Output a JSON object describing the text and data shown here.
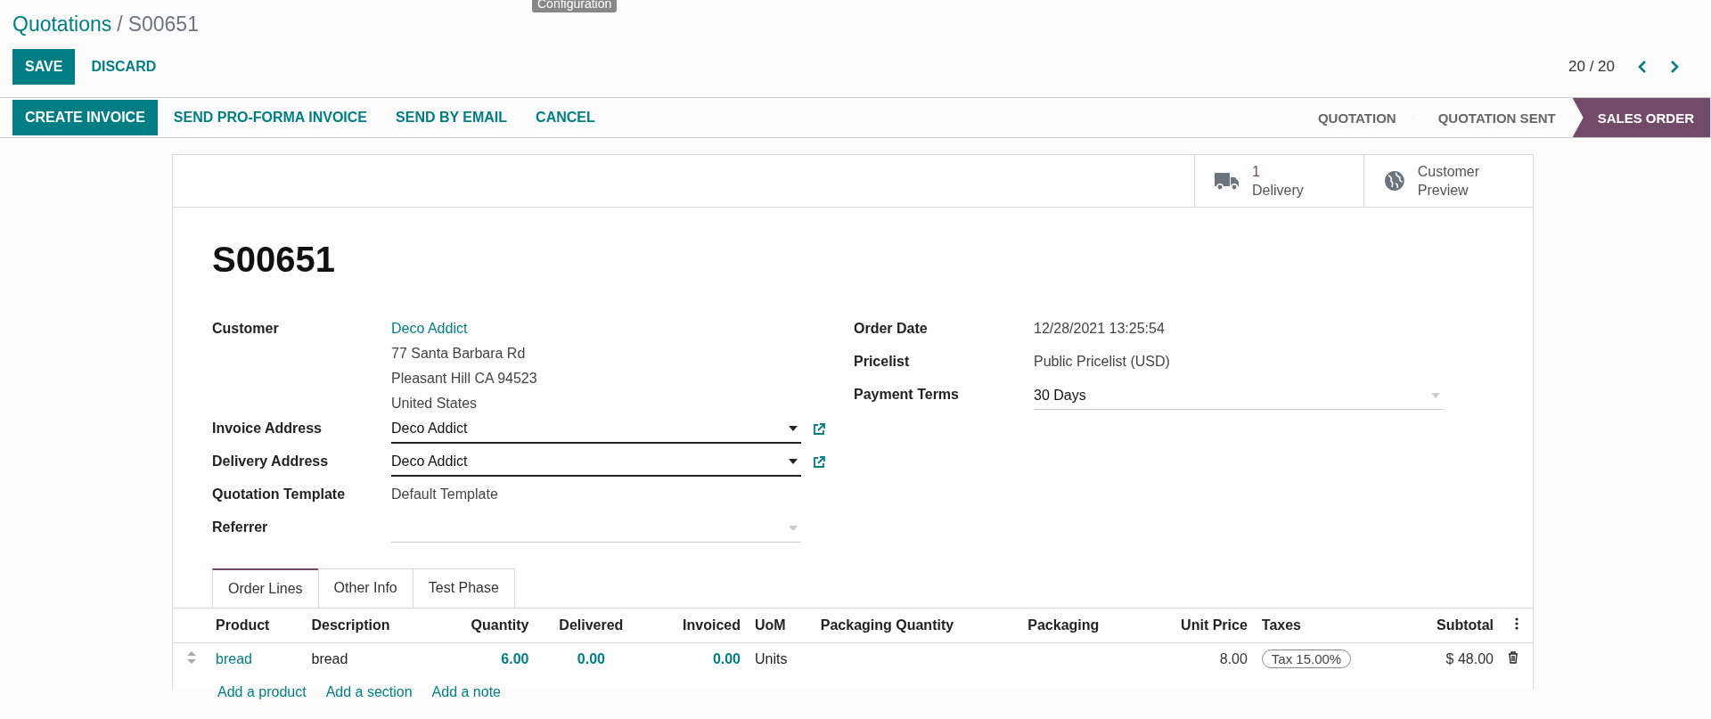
{
  "tooltip": "Configuration",
  "breadcrumb": {
    "parent": "Quotations",
    "separator": "/",
    "current": "S00651"
  },
  "edit_buttons": [
    {
      "label": "SAVE",
      "primary": true
    },
    {
      "label": "DISCARD",
      "primary": false
    }
  ],
  "pager": "20 / 20",
  "actions": [
    {
      "label": "CREATE INVOICE",
      "primary": true
    },
    {
      "label": "SEND PRO-FORMA INVOICE",
      "primary": false
    },
    {
      "label": "SEND BY EMAIL",
      "primary": false
    },
    {
      "label": "CANCEL",
      "primary": false
    }
  ],
  "stages": [
    {
      "label": "QUOTATION",
      "selected": false
    },
    {
      "label": "QUOTATION SENT",
      "selected": false
    },
    {
      "label": "SALES ORDER",
      "selected": true
    }
  ],
  "smart_buttons": [
    {
      "kind": "delivery",
      "count": "1",
      "label": "Delivery"
    },
    {
      "kind": "preview",
      "label": "Customer Preview"
    }
  ],
  "title": "S00651",
  "left_fields": [
    {
      "label": "Customer",
      "kind": "address",
      "link": "Deco Addict",
      "lines": [
        "77 Santa Barbara Rd",
        "Pleasant Hill CA 94523",
        "United States"
      ]
    },
    {
      "label": "Invoice Address",
      "kind": "select",
      "value": "Deco Addict",
      "required": true,
      "external": true
    },
    {
      "label": "Delivery Address",
      "kind": "select",
      "value": "Deco Addict",
      "required": true,
      "external": true
    },
    {
      "label": "Quotation Template",
      "kind": "text",
      "value": "Default Template"
    },
    {
      "label": "Referrer",
      "kind": "select",
      "required": false,
      "external": false
    }
  ],
  "right_fields": [
    {
      "label": "Order Date",
      "kind": "text",
      "value": "12/28/2021 13:25:54"
    },
    {
      "label": "Pricelist",
      "kind": "text",
      "value": "Public Pricelist (USD)"
    },
    {
      "label": "Payment Terms",
      "kind": "select",
      "value": "30 Days",
      "required": false,
      "external": false
    }
  ],
  "tabs": [
    {
      "label": "Order Lines",
      "selected": true
    },
    {
      "label": "Other Info",
      "selected": false
    },
    {
      "label": "Test Phase",
      "selected": false
    }
  ],
  "table": {
    "columns": [
      "Product",
      "Description",
      "Quantity",
      "Delivered",
      "Invoiced",
      "UoM",
      "Packaging Quantity",
      "Packaging",
      "Unit Price",
      "Taxes",
      "Subtotal"
    ],
    "rows": [
      {
        "cells": [
          "bread",
          "bread",
          "6.00",
          "0.00",
          "0.00",
          "Units",
          "",
          "",
          "8.00",
          "Tax 15.00%",
          "$ 48.00"
        ]
      }
    ],
    "add_links": [
      "Add a product",
      "Add a section",
      "Add a note"
    ]
  }
}
